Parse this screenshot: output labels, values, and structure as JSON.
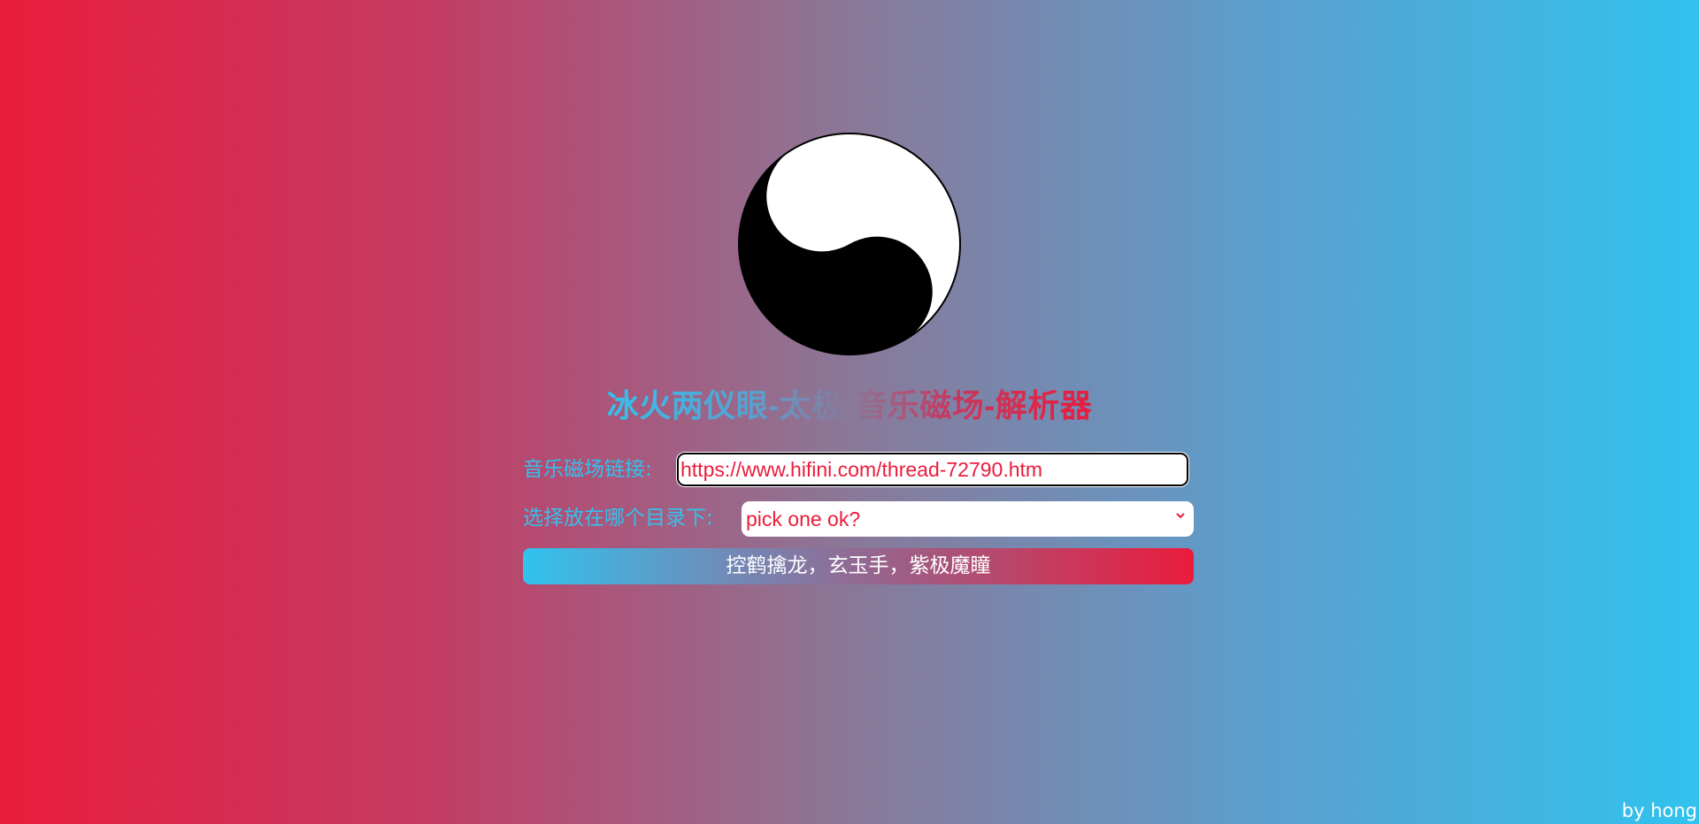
{
  "logo": {
    "icon": "yin-yang-icon"
  },
  "title": "冰火两仪眼-太极-音乐磁场-解析器",
  "form": {
    "url_label": "音乐磁场链接:",
    "url_value": "https://www.hifini.com/thread-72790.htm",
    "dir_label": "选择放在哪个目录下:",
    "dir_selected": "pick one ok?",
    "submit_label": "控鹤擒龙，玄玉手，紫极魔瞳"
  },
  "footer": {
    "credit": "by hong"
  },
  "colors": {
    "red": "#ea1c3c",
    "blue": "#31c2ee"
  }
}
